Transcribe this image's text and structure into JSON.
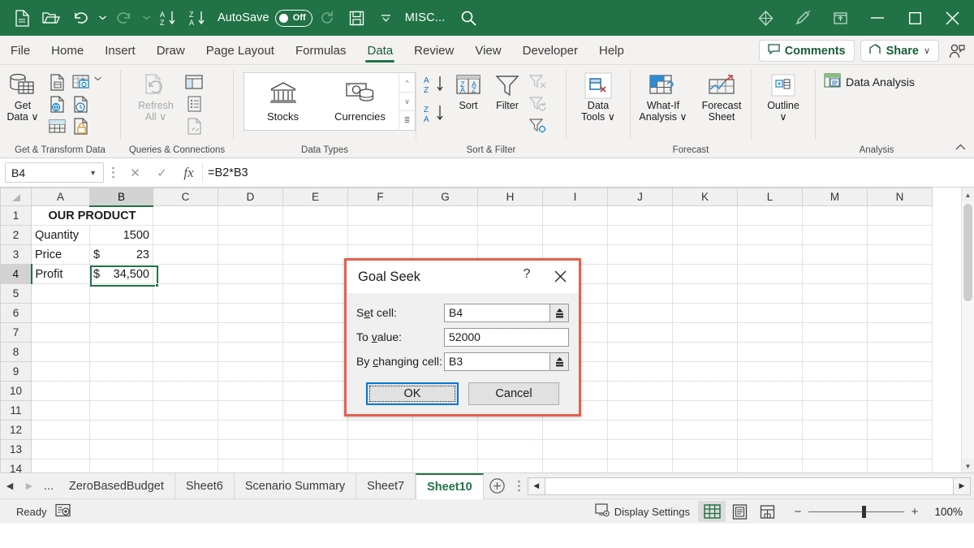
{
  "titlebar": {
    "autosave_label": "AutoSave",
    "autosave_state": "Off",
    "document_name": "MISC...",
    "icons": [
      "new-file-icon",
      "open-folder-icon",
      "undo-icon",
      "undo-dropdown-icon",
      "redo-icon",
      "redo-dropdown-icon",
      "sort-az-icon",
      "sort-za-icon",
      "repeat-icon",
      "save-icon",
      "qat-dropdown-icon",
      "search-icon",
      "diamond-icon",
      "pen-icon",
      "restore-window-icon",
      "minimize-icon",
      "maximize-icon",
      "close-icon"
    ]
  },
  "ribbon_tabs": [
    {
      "label": "File",
      "active": false
    },
    {
      "label": "Home",
      "active": false
    },
    {
      "label": "Insert",
      "active": false
    },
    {
      "label": "Draw",
      "active": false
    },
    {
      "label": "Page Layout",
      "active": false
    },
    {
      "label": "Formulas",
      "active": false
    },
    {
      "label": "Data",
      "active": true
    },
    {
      "label": "Review",
      "active": false
    },
    {
      "label": "View",
      "active": false
    },
    {
      "label": "Developer",
      "active": false
    },
    {
      "label": "Help",
      "active": false
    }
  ],
  "tabs_right": {
    "comments_label": "Comments",
    "share_label": "Share",
    "share_caret": "∨"
  },
  "ribbon_groups": [
    {
      "name": "Get & Transform Data",
      "label": "Get & Transform Data",
      "big_button": {
        "line1": "Get",
        "line2": "Data ∨"
      }
    },
    {
      "name": "Queries & Connections",
      "label": "Queries & Connections",
      "big_button": {
        "line1": "Refresh",
        "line2": "All ∨",
        "disabled": true
      }
    },
    {
      "name": "Data Types",
      "label": "Data Types",
      "gallery": [
        {
          "label": "Stocks",
          "icon": "bank-icon"
        },
        {
          "label": "Currencies",
          "icon": "currency-icon"
        }
      ]
    },
    {
      "name": "Sort & Filter",
      "label": "Sort & Filter",
      "buttons": [
        {
          "label": "Sort",
          "icon": "sort-icon"
        },
        {
          "label": "Filter",
          "icon": "filter-icon"
        }
      ],
      "small_buttons": [
        "clear-filter-icon",
        "reapply-filter-icon",
        "advanced-filter-icon"
      ]
    },
    {
      "name": "Data Tools",
      "label": "",
      "big_button": {
        "line1": "Data",
        "line2": "Tools ∨"
      }
    },
    {
      "name": "Forecast",
      "label": "Forecast",
      "buttons": [
        {
          "line1": "What-If",
          "line2": "Analysis ∨"
        },
        {
          "line1": "Forecast",
          "line2": "Sheet"
        }
      ]
    },
    {
      "name": "Outline",
      "label": "",
      "big_button": {
        "line1": "Outline",
        "line2": "∨"
      }
    },
    {
      "name": "Analysis",
      "label": "Analysis",
      "item_label": "Data Analysis"
    }
  ],
  "formula_bar": {
    "name_box": "B4",
    "formula": "=B2*B3",
    "cancel_icon": "✕",
    "enter_icon": "✓",
    "fx_icon": "fx"
  },
  "grid": {
    "columns": [
      "A",
      "B",
      "C",
      "D",
      "E",
      "F",
      "G",
      "H",
      "I",
      "J",
      "K",
      "L",
      "M",
      "N"
    ],
    "rows": [
      "1",
      "2",
      "3",
      "4",
      "5",
      "6",
      "7",
      "8",
      "9",
      "10",
      "11",
      "12",
      "13",
      "14"
    ],
    "selected_column": "B",
    "selected_row": "4",
    "selected_cell": "B4",
    "cells": {
      "A1": "OUR PRODUCT",
      "A2": "Quantity",
      "B2": "1500",
      "A3": "Price",
      "B3_symbol": "$",
      "B3_value": "23",
      "A4": "Profit",
      "B4_symbol": "$",
      "B4_value": "34,500"
    }
  },
  "dialog": {
    "title": "Goal Seek",
    "help_icon": "?",
    "close_icon": "✕",
    "fields": [
      {
        "label_pre": "S",
        "label_key": "e",
        "label_post": "t cell:",
        "value": "B4",
        "has_picker": true,
        "name": "set-cell"
      },
      {
        "label_pre": "To ",
        "label_key": "v",
        "label_post": "alue:",
        "value": "52000",
        "has_picker": false,
        "name": "to-value"
      },
      {
        "label_pre": "By ",
        "label_key": "c",
        "label_post": "hanging cell:",
        "value": "B3",
        "has_picker": true,
        "name": "by-changing-cell"
      }
    ],
    "ok_label": "OK",
    "cancel_label": "Cancel",
    "border_color": "#e4604f"
  },
  "sheet_tabs": {
    "first_icon": "◀",
    "last_icon": "▶",
    "ellipsis": "...",
    "tabs": [
      {
        "label": "ZeroBasedBudget",
        "active": false
      },
      {
        "label": "Sheet6",
        "active": false
      },
      {
        "label": "Scenario Summary",
        "active": false
      },
      {
        "label": "Sheet7",
        "active": false
      },
      {
        "label": "Sheet10",
        "active": true
      }
    ],
    "add_icon": "+"
  },
  "status_bar": {
    "status": "Ready",
    "macro_icon": "record-macro-icon",
    "display_settings": "Display Settings",
    "views": [
      {
        "name": "normal-view",
        "icon": "grid-icon",
        "active": true
      },
      {
        "name": "page-layout-view",
        "icon": "page-icon",
        "active": false
      },
      {
        "name": "page-break-view",
        "icon": "pagebreak-icon",
        "active": false
      }
    ],
    "zoom_out": "−",
    "zoom_in": "+",
    "zoom_level": "100%"
  }
}
